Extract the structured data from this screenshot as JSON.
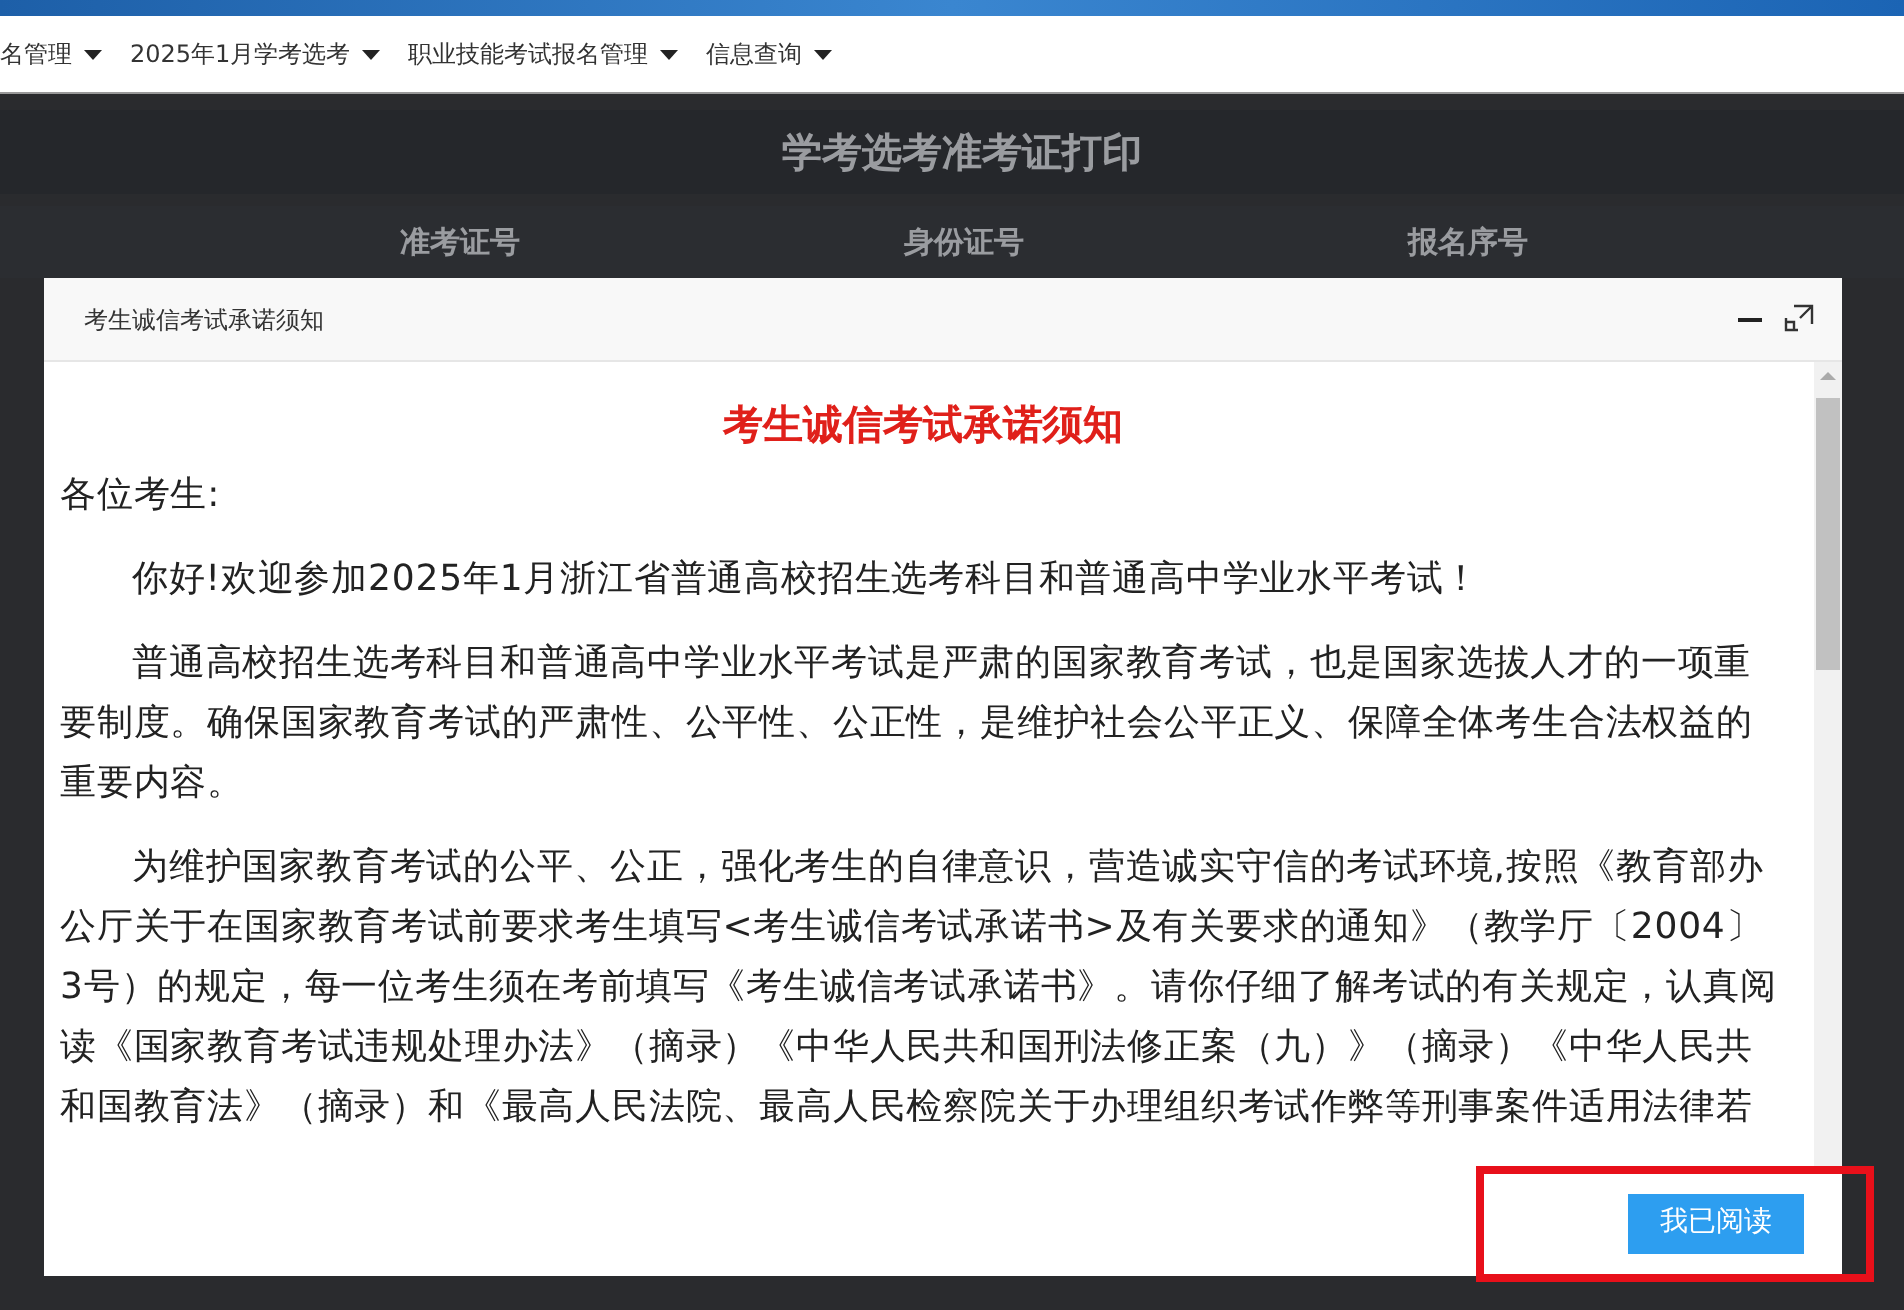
{
  "nav": {
    "items": [
      {
        "label": "名管理"
      },
      {
        "label": "2025年1月学考选考"
      },
      {
        "label": "职业技能考试报名管理"
      },
      {
        "label": "信息查询"
      }
    ]
  },
  "page": {
    "title": "学考选考准考证打印",
    "table": {
      "columns": [
        "准考证号",
        "身份证号",
        "报名序号"
      ]
    }
  },
  "dialog": {
    "title": "考生诚信考试承诺须知",
    "heading": "考生诚信考试承诺须知",
    "greeting": "各位考生:",
    "paragraphs": [
      "你好!欢迎参加2025年1月浙江省普通高校招生选考科目和普通高中学业水平考试！",
      "普通高校招生选考科目和普通高中学业水平考试是严肃的国家教育考试，也是国家选拔人才的一项重要制度。确保国家教育考试的严肃性、公平性、公正性，是维护社会公平正义、保障全体考生合法权益的重要内容。",
      "为维护国家教育考试的公平、公正，强化考生的自律意识，营造诚实守信的考试环境,按照《教育部办公厅关于在国家教育考试前要求考生填写<考生诚信考试承诺书>及有关要求的通知》（教学厅〔2004〕3号）的规定，每一位考生须在考前填写《考生诚信考试承诺书》。请你仔细了解考试的有关规定，认真阅读《国家教育考试违规处理办法》（摘录）《中华人民共和国刑法修正案（九）》（摘录）《中华人民共和国教育法》（摘录）和《最高人民法院、最高人民检察院关于办理组织考试作弊等刑事案件适用法律若"
    ],
    "button": "我已阅读"
  }
}
